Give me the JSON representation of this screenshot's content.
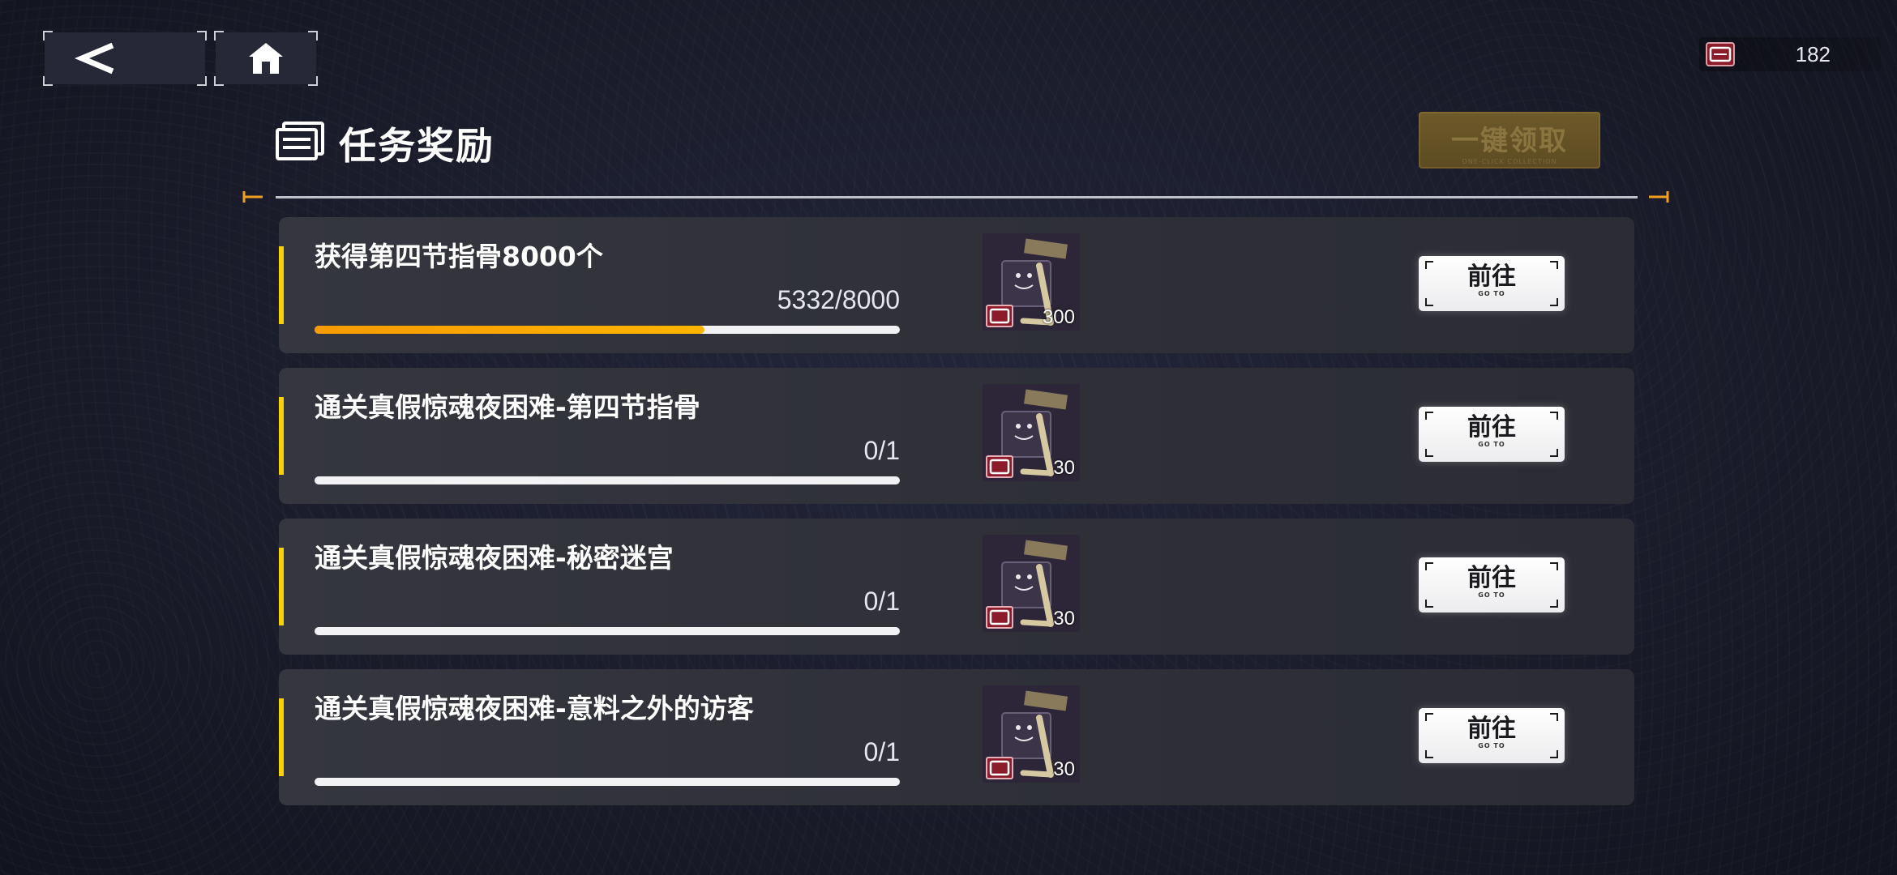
{
  "header": {
    "title": "任务奖励",
    "claim_all_label": "一键领取",
    "claim_all_sub": "ONE-CLICK COLLECTION",
    "currency_count": "182"
  },
  "icons": {
    "back": "back-arrow-icon",
    "home": "home-icon",
    "title": "task-list-icon",
    "currency": "ticket-icon"
  },
  "colors": {
    "accent": "#f6d200",
    "progress": "#f59b00",
    "claim_all": "#6d5a2a"
  },
  "tasks": [
    {
      "title": "获得第四节指骨8000个",
      "progress_text": "5332/8000",
      "progress_fraction": 0.6665,
      "reward_count": "300",
      "button_label": "前往",
      "button_sub": "GO TO"
    },
    {
      "title": "通关真假惊魂夜困难-第四节指骨",
      "progress_text": "0/1",
      "progress_fraction": 0,
      "reward_count": "30",
      "button_label": "前往",
      "button_sub": "GO TO"
    },
    {
      "title": "通关真假惊魂夜困难-秘密迷宫",
      "progress_text": "0/1",
      "progress_fraction": 0,
      "reward_count": "30",
      "button_label": "前往",
      "button_sub": "GO TO"
    },
    {
      "title": "通关真假惊魂夜困难-意料之外的访客",
      "progress_text": "0/1",
      "progress_fraction": 0,
      "reward_count": "30",
      "button_label": "前往",
      "button_sub": "GO TO"
    }
  ]
}
